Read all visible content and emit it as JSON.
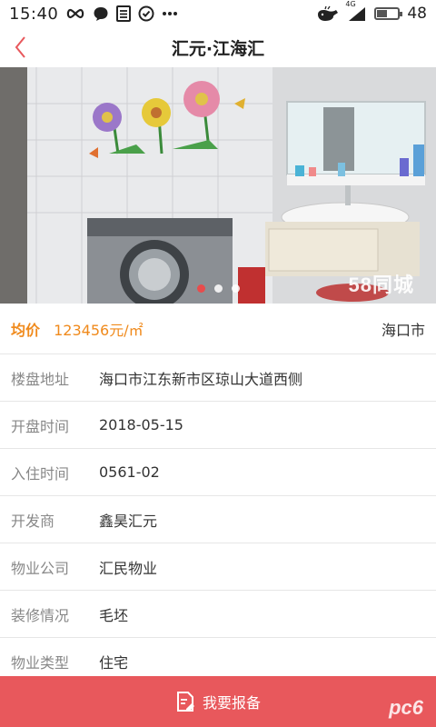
{
  "status_bar": {
    "time": "15:40",
    "network": "4G",
    "battery": "48",
    "battery_level_percent": 48,
    "icons": [
      "infinity-icon",
      "chat-icon",
      "list-icon",
      "check-circle-icon",
      "more-dots-icon",
      "whale-icon",
      "signal-icon",
      "battery-icon"
    ]
  },
  "nav": {
    "title": "汇元·江海汇",
    "back_icon": "back-chevron-icon"
  },
  "carousel": {
    "watermark": "58同城",
    "total": 3,
    "active_index": 0
  },
  "price": {
    "label": "均价",
    "value": "123456元/㎡",
    "city": "海口市"
  },
  "details": [
    {
      "label": "楼盘地址",
      "value": "海口市江东新市区琼山大道西侧"
    },
    {
      "label": "开盘时间",
      "value": "2018-05-15"
    },
    {
      "label": "入住时间",
      "value": "0561-02"
    },
    {
      "label": "开发商",
      "value": "鑫昊汇元"
    },
    {
      "label": "物业公司",
      "value": "汇民物业"
    },
    {
      "label": "装修情况",
      "value": "毛坯"
    },
    {
      "label": "物业类型",
      "value": "住宅"
    }
  ],
  "bottom": {
    "button_label": "我要报备",
    "icon": "report-doc-icon",
    "logo": "pc6"
  },
  "colors": {
    "accent": "#e8585c",
    "price": "#f08a1c",
    "back": "#e8585c"
  }
}
